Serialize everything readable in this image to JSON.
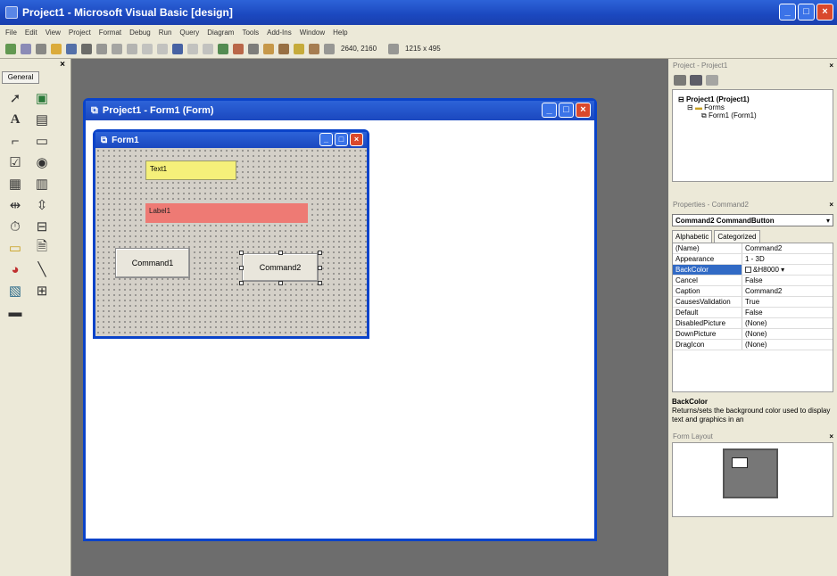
{
  "app": {
    "title": "Project1 - Microsoft Visual Basic [design]"
  },
  "menu": [
    "File",
    "Edit",
    "View",
    "Project",
    "Format",
    "Debug",
    "Run",
    "Query",
    "Diagram",
    "Tools",
    "Add-Ins",
    "Window",
    "Help"
  ],
  "toolbar": {
    "position": "2640, 2160",
    "size": "1215 x 495"
  },
  "toolbox": {
    "tab": "General"
  },
  "form_window": {
    "title": "Project1 - Form1 (Form)"
  },
  "form1": {
    "title": "Form1",
    "text1": "Text1",
    "label1": "Label1",
    "command1": "Command1",
    "command2": "Command2"
  },
  "project_panel": {
    "title": "Project - Project1",
    "project": "Project1 (Project1)",
    "folder": "Forms",
    "form": "Form1 (Form1)"
  },
  "properties_panel": {
    "title": "Properties - Command2",
    "object": "Command2 CommandButton",
    "tab_alpha": "Alphabetic",
    "tab_cat": "Categorized",
    "rows": [
      {
        "name": "(Name)",
        "value": "Command2"
      },
      {
        "name": "Appearance",
        "value": "1 - 3D"
      },
      {
        "name": "BackColor",
        "value": "&H8000"
      },
      {
        "name": "Cancel",
        "value": "False"
      },
      {
        "name": "Caption",
        "value": "Command2"
      },
      {
        "name": "CausesValidation",
        "value": "True"
      },
      {
        "name": "Default",
        "value": "False"
      },
      {
        "name": "DisabledPicture",
        "value": "(None)"
      },
      {
        "name": "DownPicture",
        "value": "(None)"
      },
      {
        "name": "DragIcon",
        "value": "(None)"
      }
    ],
    "desc_title": "BackColor",
    "desc_text": "Returns/sets the background color used to display text and graphics in an"
  },
  "layout_panel": {
    "title": "Form Layout"
  }
}
